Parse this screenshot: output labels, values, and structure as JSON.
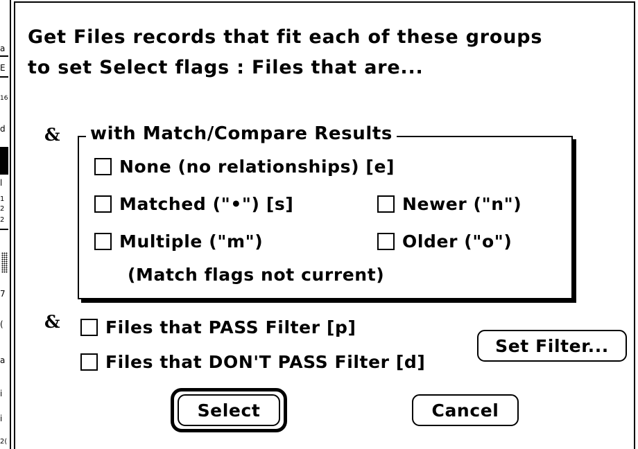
{
  "background_window": {
    "fragments": [
      "a",
      "E",
      "16",
      "d",
      "l",
      "1",
      "2",
      "2",
      "7",
      "(",
      "a",
      "i",
      "i",
      "2("
    ]
  },
  "dialog": {
    "heading_line1": "Get Files records that fit each of these groups",
    "heading_line2": "to set Select flags :   Files that are...",
    "and_symbol": "&",
    "group": {
      "title": "with Match/Compare Results",
      "options": {
        "none": "None (no relationships) [e]",
        "matched": "Matched  (\"•\") [s]",
        "newer": "Newer (\"n\")",
        "multiple": "Multiple (\"m\")",
        "older": "Older (\"o\")"
      },
      "note": "(Match flags not current)"
    },
    "filter": {
      "pass_label": "Files that PASS Filter [p]",
      "dont_pass_label": "Files that DON'T PASS Filter [d]",
      "set_filter_button": "Set Filter..."
    },
    "buttons": {
      "select": "Select",
      "cancel": "Cancel"
    }
  }
}
